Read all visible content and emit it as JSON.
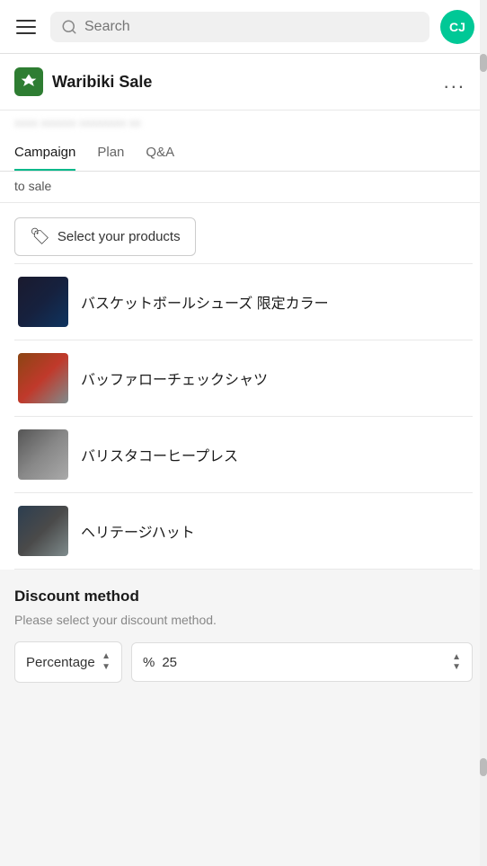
{
  "topbar": {
    "search_placeholder": "Search",
    "avatar_initials": "CJ",
    "avatar_bg": "#00c896"
  },
  "app": {
    "logo_icon": "♣",
    "title": "Waribiki Sale",
    "more_icon": "...",
    "subtitle_blurred": "xxxx xxxxxx xxxxxxxx xx"
  },
  "tabs": [
    {
      "label": "Campaign",
      "active": true
    },
    {
      "label": "Plan",
      "active": false
    },
    {
      "label": "Q&A",
      "active": false
    }
  ],
  "to_sale": {
    "text": "to sale"
  },
  "products": {
    "select_button_label": "Select your products",
    "tag_icon": "🏷",
    "items": [
      {
        "name": "バスケットボールシューズ 限定カラー",
        "thumb_class": "thumb-basketball"
      },
      {
        "name": "バッファローチェックシャツ",
        "thumb_class": "thumb-buffalo"
      },
      {
        "name": "バリスタコーヒープレス",
        "thumb_class": "thumb-barista"
      },
      {
        "name": "ヘリテージハット",
        "thumb_class": "thumb-hat"
      }
    ]
  },
  "discount": {
    "title": "Discount method",
    "subtitle": "Please select your discount method.",
    "method_label": "Percentage",
    "percent_symbol": "%",
    "percent_value": "25"
  }
}
